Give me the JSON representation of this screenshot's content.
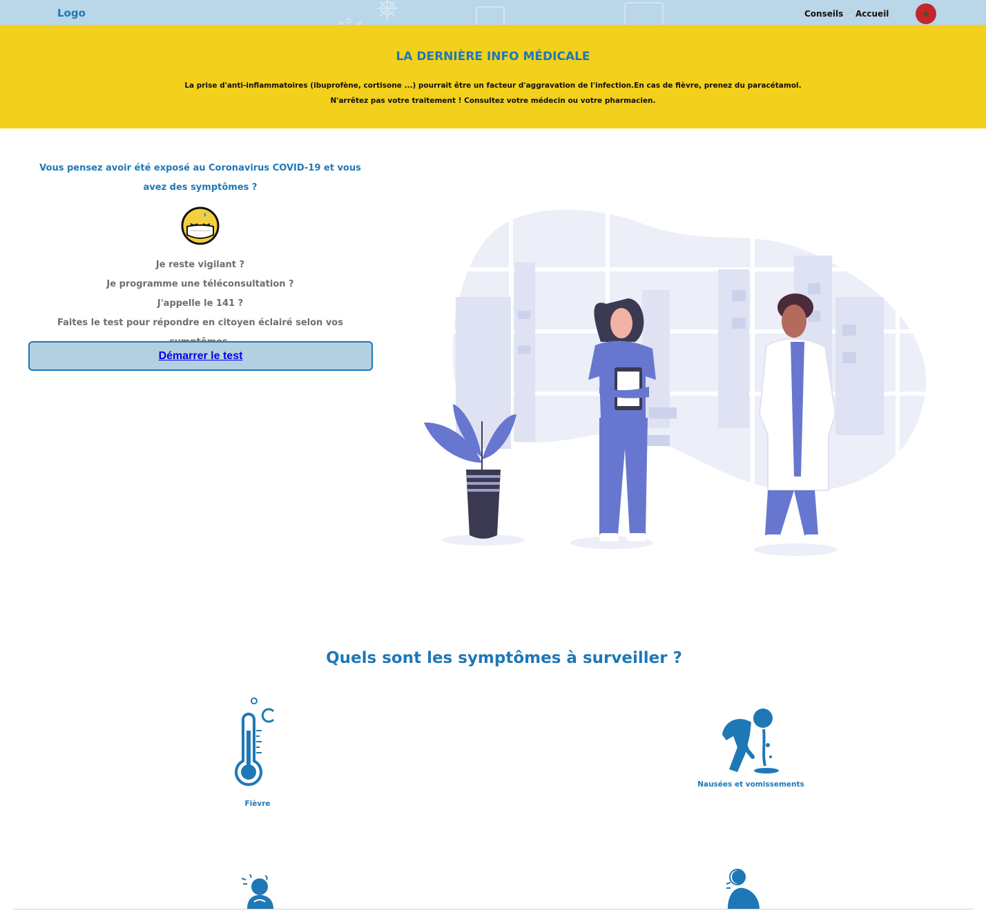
{
  "header": {
    "logo": "Logo",
    "nav": {
      "conseils": "Conseils",
      "accueil": "Accueil"
    },
    "flag_icon": "morocco-flag-icon"
  },
  "banner": {
    "title": "LA DERNIÈRE INFO MÉDICALE",
    "line1": "La prise d'anti-inflammatoires (ibuprofène, cortisone ...) pourrait être un facteur d'aggravation de l'infection.En cas de fièvre, prenez du paracétamol.",
    "line2": "N'arrêtez pas votre traitement ! Consultez votre médecin ou votre pharmacien."
  },
  "hero": {
    "question": "Vous pensez avoir été exposé au Coronavirus COVID-19 et vous avez des symptômes ?",
    "lines": [
      "Je reste vigilant ?",
      "Je programme une téléconsultation ?",
      "J'appelle le 141 ?",
      "Faites le test pour répondre en citoyen éclairé selon vos symptômes."
    ],
    "button": "Démarrer le test"
  },
  "symptoms": {
    "title": "Quels sont les symptômes à surveiller ?",
    "items": [
      {
        "label": "Fièvre",
        "icon": "thermometer-icon"
      },
      {
        "label": "Nausées et vomissements",
        "icon": "vomiting-person-icon"
      }
    ]
  },
  "colors": {
    "brand_blue": "#1e78b6",
    "banner_yellow": "#f3d01b",
    "topbar_bg": "#b9d7e8"
  }
}
